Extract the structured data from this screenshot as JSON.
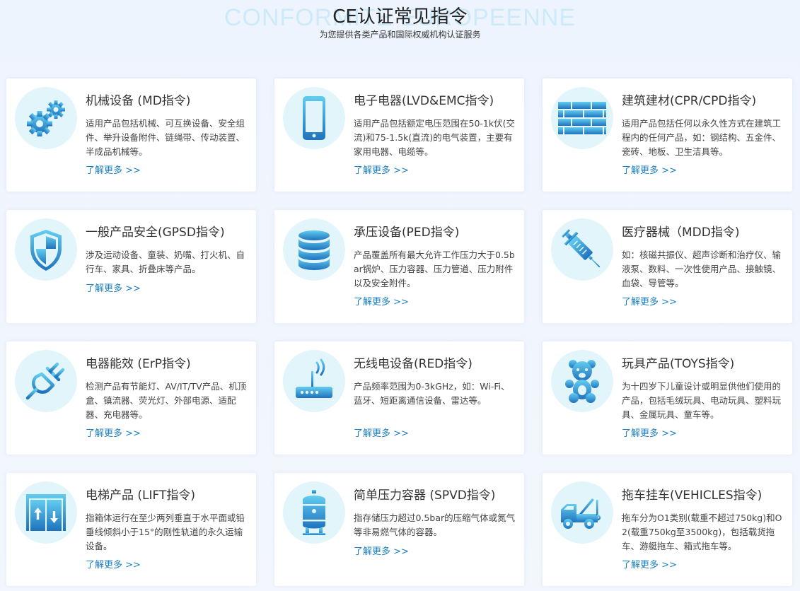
{
  "header": {
    "watermark": "CONFORMITE EUROPEENNE",
    "title": "CE认证常见指令",
    "subtitle": "为您提供各类产品和国际权威机构认证服务"
  },
  "colors": {
    "accent": "#1a7fc1",
    "icon_light": "#5ec8ee",
    "icon_dark": "#1f76c0",
    "icon_bg": "#e2f5fb"
  },
  "cards": [
    {
      "icon": "gears-icon",
      "title": "机械设备 (MD指令)",
      "desc": "适用产品包括机械、可互换设备、安全组件、举升设备附件、链绳带、传动装置、半成品机械等。",
      "more": "了解更多 >>"
    },
    {
      "icon": "phone-icon",
      "title": "电子电器(LVD&EMC指令)",
      "desc": "适用产品包括额定电压范围在50-1k伏(交流)和75-1.5k(直流)的电气装置，主要有家用电器、电缆等。",
      "more": "了解更多 >>"
    },
    {
      "icon": "brick-wall-icon",
      "title": "建筑建材(CPR/CPD指令)",
      "desc": "适用产品包括任何以永久性方式在建筑工程内的任何产品，如：钢结构、五金件、瓷砖、地板、卫生洁具等。",
      "more": "了解更多 >>"
    },
    {
      "icon": "shield-icon",
      "title": "一般产品安全(GPSD指令)",
      "desc": "涉及运动设备、童装、奶嘴、打火机、自行车、家具、折叠床等产品。",
      "more": "了解更多 >>"
    },
    {
      "icon": "database-cylinder-icon",
      "title": "承压设备(PED指令)",
      "desc": "产品覆盖所有最大允许工作压力大于0.5bar锅炉、压力容器、压力管道、压力附件以及安全附件。",
      "more": "了解更多 >>"
    },
    {
      "icon": "syringe-icon",
      "title": "医疗器械（MDD指令)",
      "desc": "如：核磁共振仪、超声诊断和治疗仪、输液泵、数料、一次性使用产品、接触镜、血袋、导管等。",
      "more": "了解更多 >>"
    },
    {
      "icon": "plug-icon",
      "title": "电器能效 (ErP指令)",
      "desc": "检测产品有节能灯、AV/IT/TV产品、机顶盒、镇流器、荧光灯、外部电源、适配器、充电器等。",
      "more": "了解更多 >>"
    },
    {
      "icon": "wifi-router-icon",
      "title": "无线电设备(RED指令)",
      "desc": "产品频率范围为0-3kGHz，如：Wi-Fi、蓝牙、短距离通信设备、雷达等。",
      "more": "了解更多 >>"
    },
    {
      "icon": "teddy-bear-icon",
      "title": "玩具产品(TOYS指令)",
      "desc": "为十四岁下儿童设计或明显供他们使用的产品，包括毛绒玩具、电动玩具、塑料玩具、金属玩具、童车等。",
      "more": "了解更多 >>"
    },
    {
      "icon": "elevator-icon",
      "title": "电梯产品 (LIFT指令)",
      "desc": "指箱体运行在至少两列垂直于水平面或铅垂线倾斜小于15°的刚性轨道的永久运输设备。",
      "more": "了解更多 >>"
    },
    {
      "icon": "pressure-tank-icon",
      "title": "简单压力容器 (SPVD指令)",
      "desc": "指存储压力超过0.5bar的压缩气体或氮气等非易燃气体的容器。",
      "more": "了解更多 >>"
    },
    {
      "icon": "tow-truck-icon",
      "title": "拖车挂车(VEHICLES指令)",
      "desc": "拖车分为O1类别(载重不超过750kg)和O2(载重750kg至3500kg)，包括载货拖车、游艇拖车、箱式拖车等。",
      "more": "了解更多 >>"
    }
  ]
}
